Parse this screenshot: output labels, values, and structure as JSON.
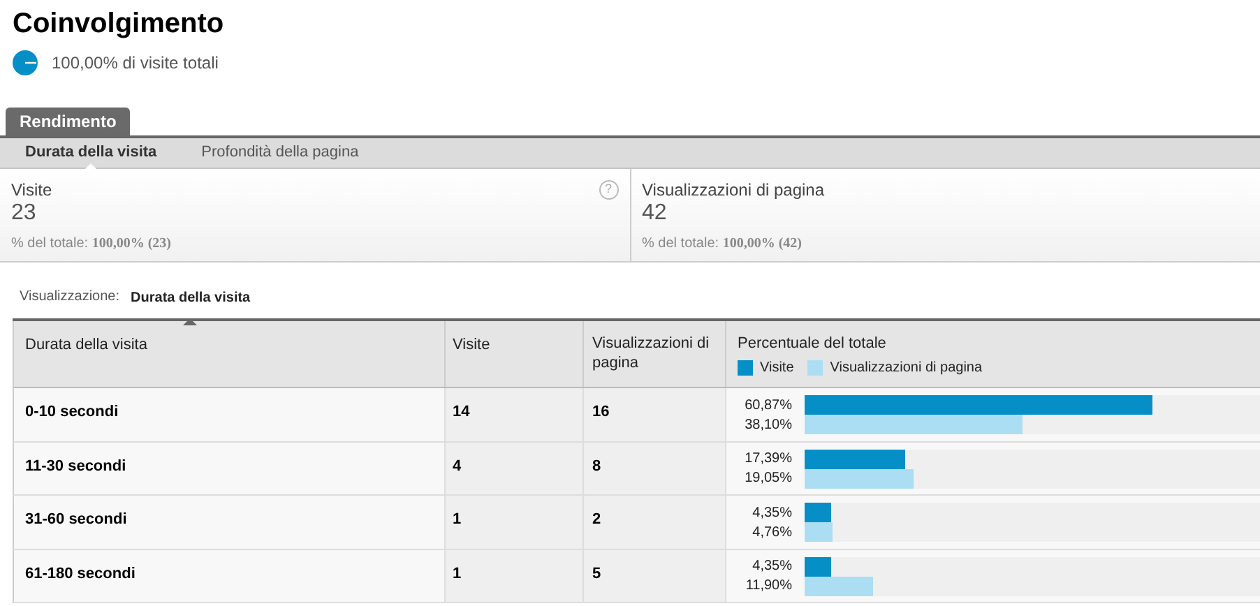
{
  "header": {
    "title": "Coinvolgimento",
    "subtitle": "100,00% di visite totali"
  },
  "tabs": [
    {
      "label": "Rendimento",
      "selected": true
    }
  ],
  "subtabs": [
    {
      "label": "Durata della visita",
      "selected": true
    },
    {
      "label": "Profondità della pagina",
      "selected": false
    }
  ],
  "metrics": [
    {
      "label": "Visite",
      "value": "23",
      "share_label": "% del totale:",
      "share": "100,00% (23)",
      "help": "?"
    },
    {
      "label": "Visualizzazioni di pagina",
      "value": "42",
      "share_label": "% del totale:",
      "share": "100,00% (42)"
    }
  ],
  "view": {
    "label": "Visualizzazione:",
    "value": "Durata della visita"
  },
  "table": {
    "columns": [
      "Durata della visita",
      "Visite",
      "Visualizzazioni di pagina",
      "Percentuale del totale"
    ],
    "legend": [
      {
        "label": "Visite",
        "color": "#068fc7"
      },
      {
        "label": "Visualizzazioni di pagina",
        "color": "#acdef3"
      }
    ],
    "rows": [
      {
        "duration": "0-10 secondi",
        "visits": "14",
        "pageviews": "16",
        "bars": [
          {
            "reading": "60,87%",
            "level": 0.763
          },
          {
            "reading": "38,10%",
            "level": 0.48
          }
        ]
      },
      {
        "duration": "11-30 secondi",
        "visits": "4",
        "pageviews": "8",
        "bars": [
          {
            "reading": "17,39%",
            "level": 0.221
          },
          {
            "reading": "19,05%",
            "level": 0.24
          }
        ]
      },
      {
        "duration": "31-60 secondi",
        "visits": "1",
        "pageviews": "2",
        "bars": [
          {
            "reading": "4,35%",
            "level": 0.057
          },
          {
            "reading": "4,76%",
            "level": 0.06
          }
        ]
      },
      {
        "duration": "61-180 secondi",
        "visits": "1",
        "pageviews": "5",
        "bars": [
          {
            "reading": "4,35%",
            "level": 0.057
          },
          {
            "reading": "11,90%",
            "level": 0.151
          }
        ]
      }
    ]
  }
}
